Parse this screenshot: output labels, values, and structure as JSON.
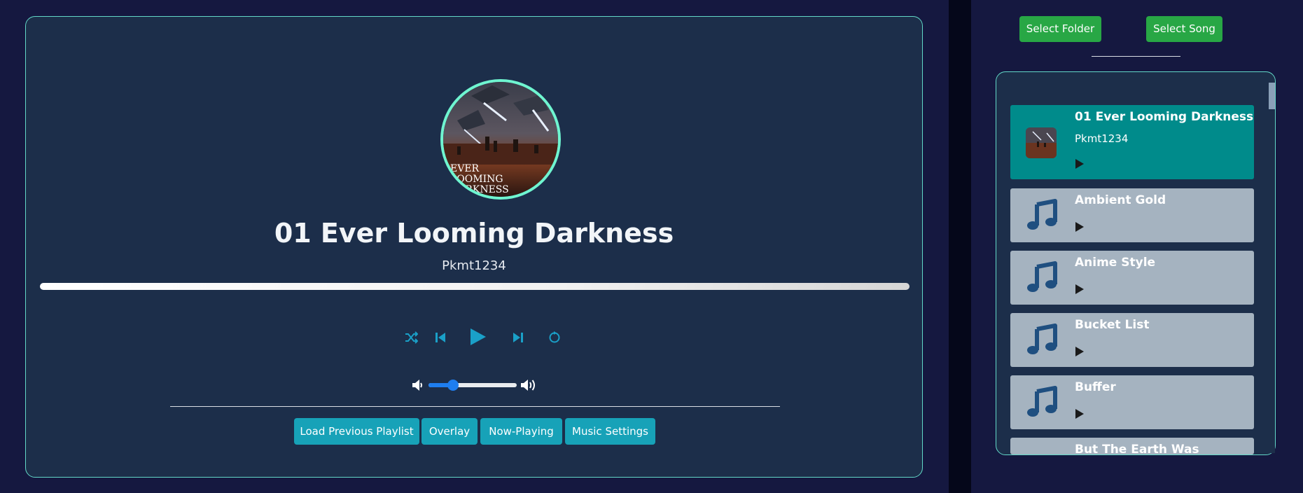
{
  "player": {
    "title": "01 Ever Looming Darkness",
    "artist": "Pkmt1234",
    "album_art_text": "EVER LOOMING DARKNESS",
    "progress": 0.0,
    "volume": 0.28,
    "controls": [
      "shuffle-icon",
      "previous-icon",
      "play-icon",
      "next-icon",
      "repeat-icon"
    ],
    "buttons": [
      "Load Previous Playlist",
      "Overlay",
      "Now-Playing",
      "Music Settings"
    ]
  },
  "sidebar": {
    "select_folder": "Select Folder",
    "select_song": "Select Song",
    "playlist": [
      {
        "name": "01 Ever Looming Darkness",
        "artist": "Pkmt1234",
        "active": true
      },
      {
        "name": "Ambient Gold",
        "artist": ""
      },
      {
        "name": "Anime Style",
        "artist": ""
      },
      {
        "name": "Bucket List",
        "artist": ""
      },
      {
        "name": "Buffer",
        "artist": ""
      },
      {
        "name": "But The Earth Was",
        "artist": ""
      }
    ]
  },
  "colors": {
    "card_bg": "#1c2e4a",
    "card_border": "#62d8c8",
    "accent_teal": "#17a2b8",
    "active_item": "#008b8b",
    "inactive_item": "#a5b3c0",
    "green_button": "#28a745",
    "volume_blue": "#1e7ef0"
  }
}
